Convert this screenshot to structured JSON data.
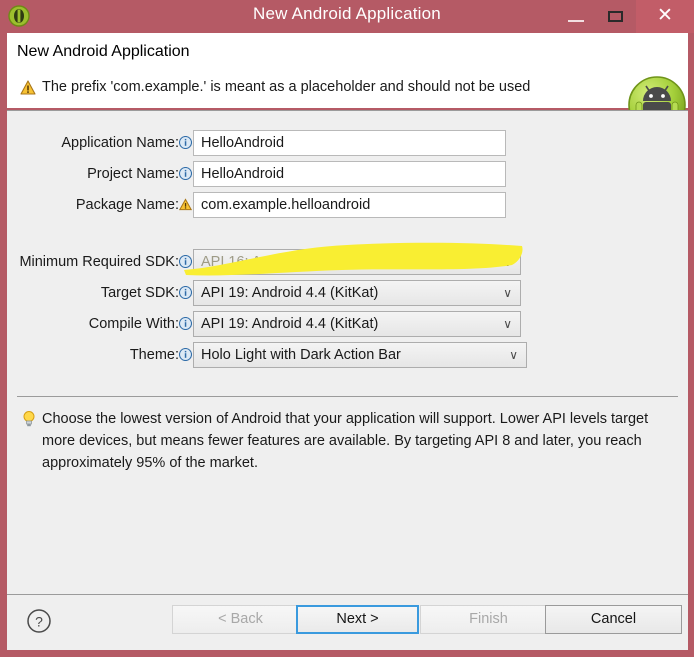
{
  "window": {
    "title": "New Android Application",
    "app_icon": "android-head-icon",
    "controls": {
      "minimize": "minimize-button",
      "maximize": "maximize-button",
      "close_glyph": "✕"
    },
    "colors": {
      "titlebar": "#b55a65",
      "close_hover": "#c25d68",
      "body": "#efefef",
      "header": "#ffffff",
      "highlight": "#f7ea2c",
      "focus_blue": "#3a9ade"
    }
  },
  "header": {
    "title": "New Android Application",
    "warning_icon": "warning-triangle-icon",
    "warning_text": "The prefix 'com.example.' is meant as a placeholder and should not be used",
    "mascot_icon": "android-mascot-icon"
  },
  "form": {
    "fields": [
      {
        "label": "Application Name:",
        "icon": "info-icon",
        "type": "text",
        "value": "HelloAndroid",
        "name": "application-name"
      },
      {
        "label": "Project Name:",
        "icon": "info-icon",
        "type": "text",
        "value": "HelloAndroid",
        "name": "project-name"
      },
      {
        "label": "Package Name:",
        "icon": "warning-icon",
        "type": "text",
        "value": "com.example.helloandroid",
        "name": "package-name"
      },
      {
        "label": "Minimum Required SDK:",
        "icon": "info-icon",
        "type": "combo",
        "value": "API 16: Android 4.1 (Jelly Bean)",
        "name": "minimum-required-sdk",
        "highlighted": true
      },
      {
        "label": "Target SDK:",
        "icon": "info-icon",
        "type": "combo",
        "value": "API 19: Android 4.4 (KitKat)",
        "name": "target-sdk"
      },
      {
        "label": "Compile With:",
        "icon": "info-icon",
        "type": "combo",
        "value": "API 19: Android 4.4 (KitKat)",
        "name": "compile-with"
      },
      {
        "label": "Theme:",
        "icon": "info-icon",
        "type": "combo",
        "value": "Holo Light with Dark Action Bar",
        "name": "theme"
      }
    ],
    "chevron_glyph": "∨"
  },
  "tip": {
    "icon": "lightbulb-icon",
    "text": "Choose the lowest version of Android that your application will support. Lower API levels target more devices, but means fewer features are available. By targeting API 8 and later, you reach approximately 95% of the market."
  },
  "footer": {
    "help_icon": "help-question-icon",
    "buttons": [
      {
        "label": "< Back",
        "name": "back-button",
        "state": "disabled"
      },
      {
        "label": "Next >",
        "name": "next-button",
        "state": "primary"
      },
      {
        "label": "Finish",
        "name": "finish-button",
        "state": "disabled"
      },
      {
        "label": "Cancel",
        "name": "cancel-button",
        "state": "enabled"
      }
    ]
  }
}
